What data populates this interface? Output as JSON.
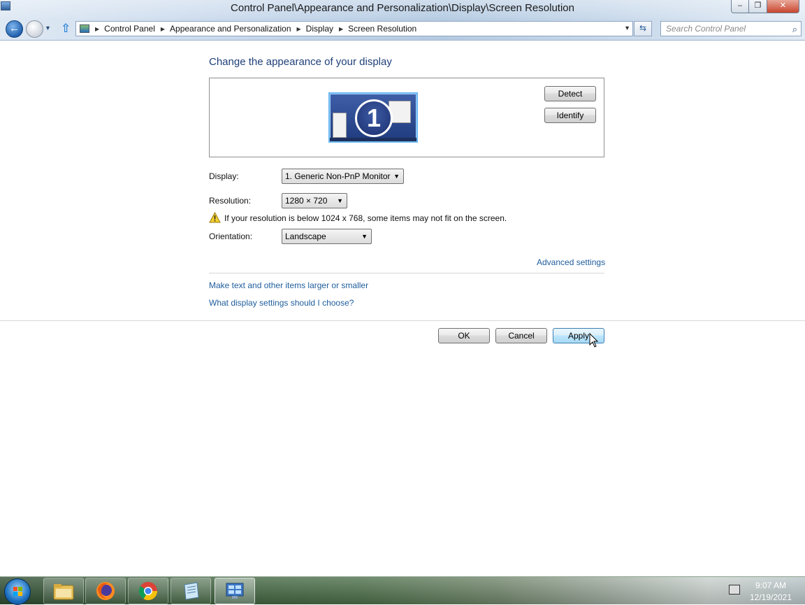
{
  "window": {
    "title": "Control Panel\\Appearance and Personalization\\Display\\Screen Resolution",
    "min_glyph": "–",
    "max_glyph": "❐",
    "close_glyph": "✕"
  },
  "nav": {
    "back_glyph": "←",
    "up_glyph": "⇧",
    "dropdown_glyph": "▼",
    "refresh_glyph": "⇆",
    "breadcrumb": [
      "Control Panel",
      "Appearance and Personalization",
      "Display",
      "Screen Resolution"
    ],
    "search_placeholder": "Search Control Panel",
    "search_icon_glyph": "⌕"
  },
  "main": {
    "heading": "Change the appearance of your display",
    "monitor_number": "1",
    "detect_label": "Detect",
    "identify_label": "Identify",
    "display_label": "Display:",
    "display_value": "1. Generic Non-PnP Monitor",
    "resolution_label": "Resolution:",
    "resolution_value": "1280 × 720",
    "warning_text": "If your resolution is below 1024 x 768, some items may not fit on the screen.",
    "orientation_label": "Orientation:",
    "orientation_value": "Landscape",
    "advanced_link": "Advanced settings",
    "link_larger_text": "Make text and other items larger or smaller",
    "link_help": "What display settings should I choose?",
    "ok_label": "OK",
    "cancel_label": "Cancel",
    "apply_label": "Apply",
    "select_arrow": "▼"
  },
  "taskbar": {
    "apps": [
      "file-explorer",
      "firefox",
      "chrome",
      "notepad",
      "control-panel"
    ],
    "clock_time": "9:07 AM",
    "clock_date": "12/19/2021"
  },
  "colors": {
    "heading": "#1e3f78",
    "link": "#1f5d9c",
    "apply_border": "#3c7fb1"
  }
}
